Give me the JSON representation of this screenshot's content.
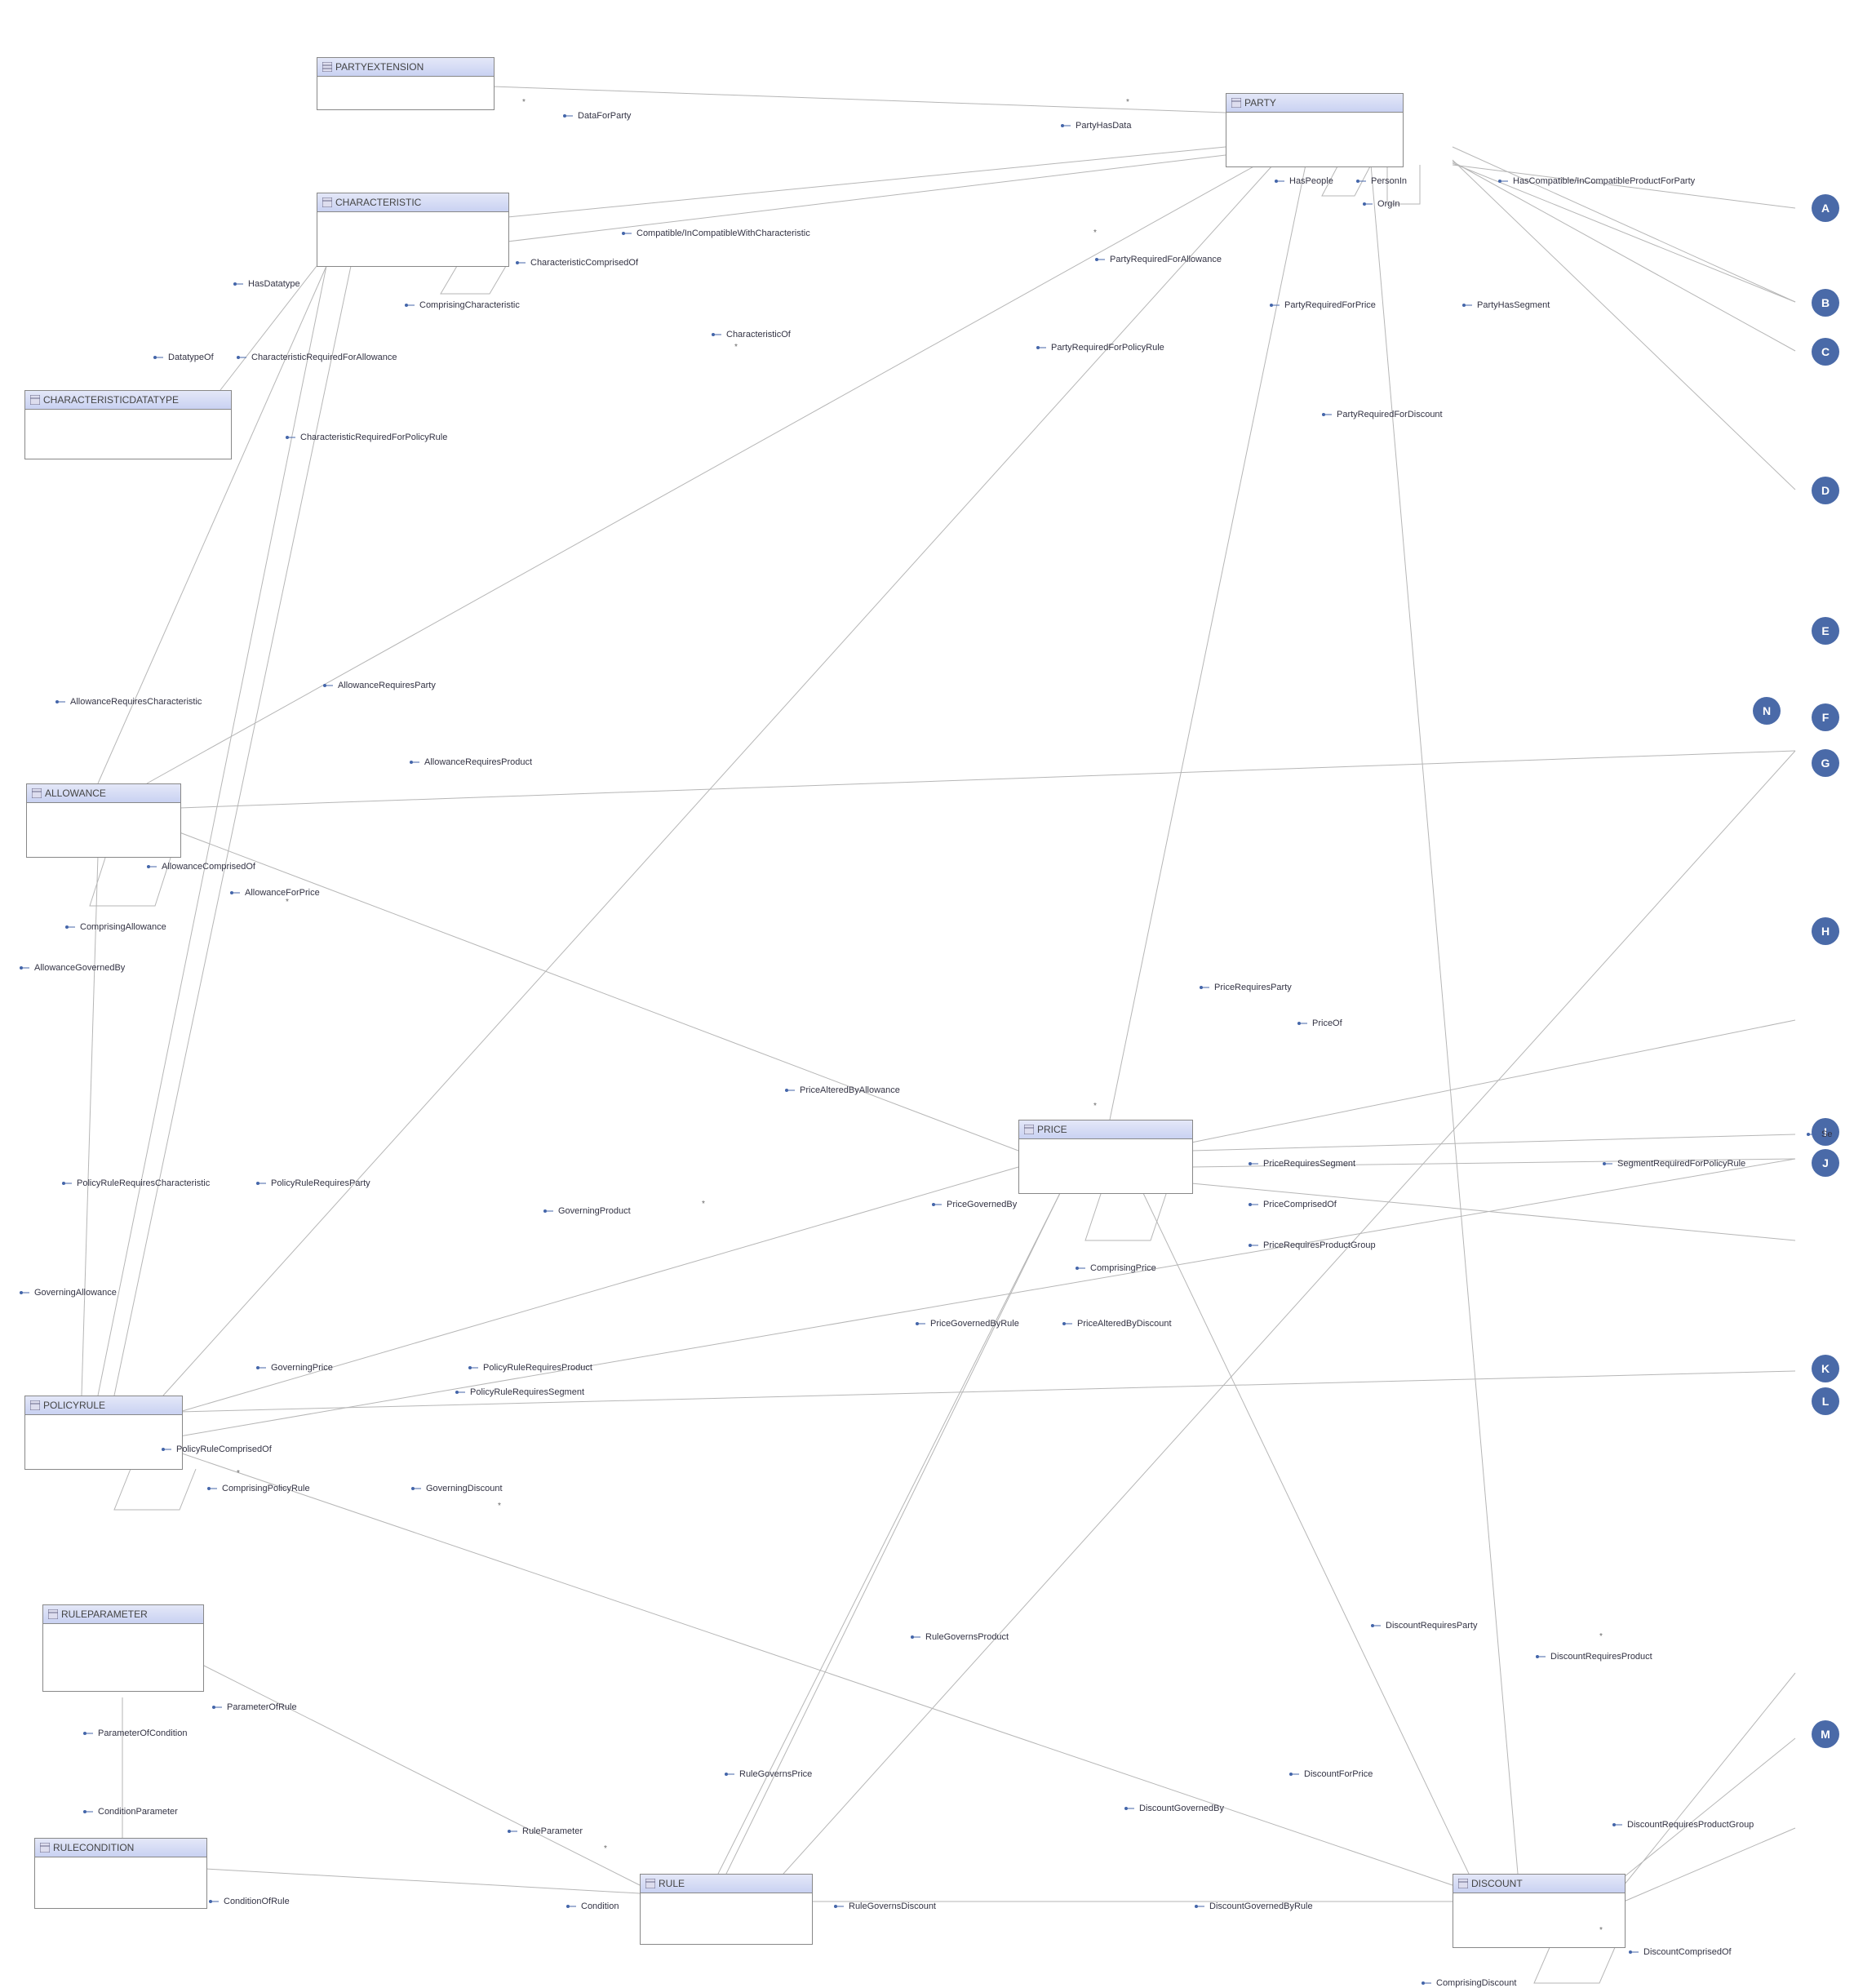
{
  "entities": {
    "partyextension": "PARTYEXTENSION",
    "party": "PARTY",
    "characteristic": "CHARACTERISTIC",
    "characteristicdatatype": "CHARACTERISTICDATATYPE",
    "allowance": "ALLOWANCE",
    "price": "PRICE",
    "policyrule": "POLICYRULE",
    "ruleparameter": "RULEPARAMETER",
    "rulecondition": "RULECONDITION",
    "rule": "RULE",
    "discount": "DISCOUNT"
  },
  "rels": {
    "dataForParty": "DataForParty",
    "partyHasData": "PartyHasData",
    "hasPeople": "HasPeople",
    "personIn": "PersonIn",
    "orgIn": "OrgIn",
    "hasCompInCompProductForParty": "HasCompatible/InCompatibleProductForParty",
    "compatibleWithCharacteristic": "Compatible/InCompatibleWithCharacteristic",
    "characteristicComprisedOf": "CharacteristicComprisedOf",
    "comprisingCharacteristic": "ComprisingCharacteristic",
    "hasDatatype": "HasDatatype",
    "datatypeOf": "DatatypeOf",
    "characteristicRequiredForAllowance": "CharacteristicRequiredForAllowance",
    "characteristicRequiredForPolicyRule": "CharacteristicRequiredForPolicyRule",
    "characteristicOf": "CharacteristicOf",
    "partyRequiredForAllowance": "PartyRequiredForAllowance",
    "partyRequiredForPolicyRule": "PartyRequiredForPolicyRule",
    "partyRequiredForPrice": "PartyRequiredForPrice",
    "partyHasSegment": "PartyHasSegment",
    "partyRequiredForDiscount": "PartyRequiredForDiscount",
    "allowanceRequiresCharacteristic": "AllowanceRequiresCharacteristic",
    "allowanceRequiresParty": "AllowanceRequiresParty",
    "allowanceRequiresProduct": "AllowanceRequiresProduct",
    "allowanceComprisedOf": "AllowanceComprisedOf",
    "comprisingAllowance": "ComprisingAllowance",
    "allowanceForPrice": "AllowanceForPrice",
    "allowanceGovernedBy": "AllowanceGovernedBy",
    "priceRequiresParty": "PriceRequiresParty",
    "priceOf": "PriceOf",
    "priceAlteredByAllowance": "PriceAlteredByAllowance",
    "priceRequiresSegment": "PriceRequiresSegment",
    "segmentRequiredForPolicyRule": "SegmentRequiredForPolicyRule",
    "priceGovernedBy": "PriceGovernedBy",
    "priceComprisedOf": "PriceComprisedOf",
    "comprisingPrice": "ComprisingPrice",
    "priceRequiresProductGroup": "PriceRequiresProductGroup",
    "priceGovernedByRule": "PriceGovernedByRule",
    "priceAlteredByDiscount": "PriceAlteredByDiscount",
    "se": "Se",
    "policyRuleRequiresCharacteristic": "PolicyRuleRequiresCharacteristic",
    "policyRuleRequiresParty": "PolicyRuleRequiresParty",
    "governingProduct": "GoverningProduct",
    "governingAllowance": "GoverningAllowance",
    "governingPrice": "GoverningPrice",
    "policyRuleRequiresProduct": "PolicyRuleRequiresProduct",
    "policyRuleRequiresSegment": "PolicyRuleRequiresSegment",
    "policyRuleComprisedOf": "PolicyRuleComprisedOf",
    "comprisingPolicyRule": "ComprisingPolicyRule",
    "governingDiscount": "GoverningDiscount",
    "parameterOfRule": "ParameterOfRule",
    "parameterOfCondition": "ParameterOfCondition",
    "conditionParameter": "ConditionParameter",
    "conditionOfRule": "ConditionOfRule",
    "condition": "Condition",
    "ruleParameter": "RuleParameter",
    "ruleGovernsProduct": "RuleGovernsProduct",
    "ruleGovernsPrice": "RuleGovernsPrice",
    "ruleGovernsDiscount": "RuleGovernsDiscount",
    "discountRequiresParty": "DiscountRequiresParty",
    "discountRequiresProduct": "DiscountRequiresProduct",
    "discountForPrice": "DiscountForPrice",
    "discountGovernedBy": "DiscountGovernedBy",
    "discountRequiresProductGroup": "DiscountRequiresProductGroup",
    "discountGovernedByRule": "DiscountGovernedByRule",
    "discountComprisedOf": "DiscountComprisedOf",
    "comprisingDiscount": "ComprisingDiscount"
  },
  "letters": [
    "A",
    "B",
    "C",
    "D",
    "E",
    "F",
    "G",
    "H",
    "I",
    "J",
    "K",
    "L",
    "M",
    "N"
  ]
}
